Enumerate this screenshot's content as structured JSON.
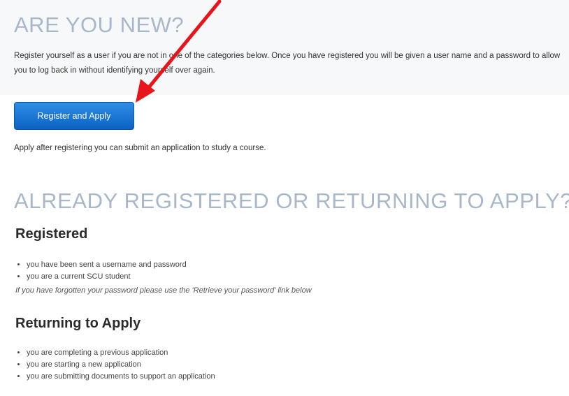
{
  "new_section": {
    "heading": "ARE YOU NEW?",
    "description": "Register yourself as a user if you are not in one of the categories below. Once you have registered you will be given a user name and a password to allow you to log back in without identifying yourself over again.",
    "register_button_label": "Register and Apply",
    "apply_note": "Apply after registering you can submit an application to study a course."
  },
  "returning_section": {
    "heading": "ALREADY REGISTERED OR RETURNING TO APPLY?",
    "registered": {
      "title": "Registered",
      "items": [
        "you have been sent a username and password",
        "you are a current SCU student"
      ],
      "note": "If you have forgotten your password please use the 'Retrieve your password' link below"
    },
    "returning": {
      "title": "Returning to Apply",
      "items": [
        "you are completing a previous application",
        "you are starting a new application",
        "you are submitting documents to support an application"
      ]
    }
  },
  "annotation": {
    "arrow_color": "#e8141b"
  }
}
